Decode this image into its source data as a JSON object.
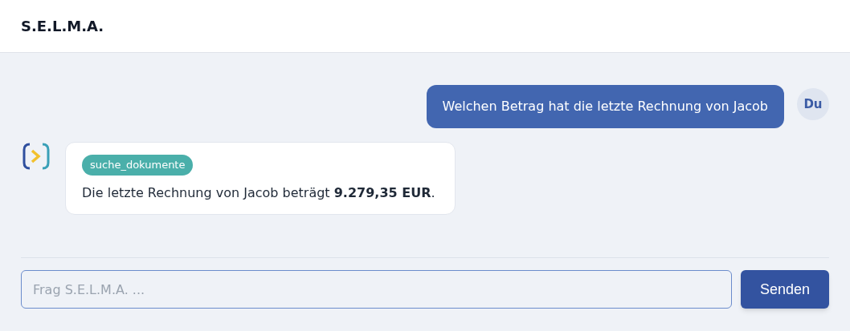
{
  "header": {
    "title": "S.E.L.M.A."
  },
  "messages": [
    {
      "kind": "user",
      "text": "Welchen Betrag hat die letzte Rechnung von Jacob",
      "avatar": "Du"
    },
    {
      "kind": "assistant",
      "tool": "suche_dokumente",
      "text": "Die letzte Rechnung von Jacob beträgt **9.279,35 EUR**."
    }
  ],
  "composer": {
    "placeholder": "Frag S.E.L.M.A. ...",
    "button": "Senden"
  }
}
